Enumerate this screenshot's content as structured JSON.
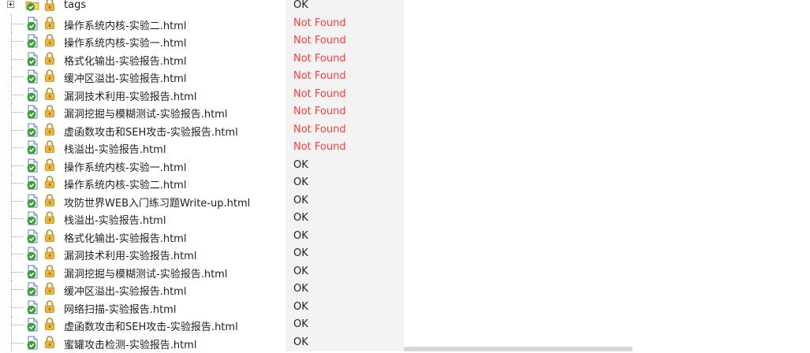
{
  "tree": {
    "root": {
      "name": "tags",
      "status": "OK",
      "status_kind": "ok"
    },
    "items": [
      {
        "name": "操作系统内核-实验二.html",
        "status": "Not Found",
        "status_kind": "nf"
      },
      {
        "name": "操作系统内核-实验一.html",
        "status": "Not Found",
        "status_kind": "nf"
      },
      {
        "name": "格式化输出-实验报告.html",
        "status": "Not Found",
        "status_kind": "nf"
      },
      {
        "name": "缓冲区溢出-实验报告.html",
        "status": "Not Found",
        "status_kind": "nf"
      },
      {
        "name": "漏洞技术利用-实验报告.html",
        "status": "Not Found",
        "status_kind": "nf"
      },
      {
        "name": "漏洞挖掘与模糊测试-实验报告.html",
        "status": "Not Found",
        "status_kind": "nf"
      },
      {
        "name": "虚函数攻击和SEH攻击-实验报告.html",
        "status": "Not Found",
        "status_kind": "nf"
      },
      {
        "name": "栈溢出-实验报告.html",
        "status": "Not Found",
        "status_kind": "nf"
      },
      {
        "name": "操作系统内核-实验一.html",
        "status": "OK",
        "status_kind": "ok"
      },
      {
        "name": "操作系统内核-实验二.html",
        "status": "OK",
        "status_kind": "ok"
      },
      {
        "name": "攻防世界WEB入门练习题Write-up.html",
        "status": "OK",
        "status_kind": "ok"
      },
      {
        "name": "栈溢出-实验报告.html",
        "status": "OK",
        "status_kind": "ok"
      },
      {
        "name": "格式化输出-实验报告.html",
        "status": "OK",
        "status_kind": "ok"
      },
      {
        "name": "漏洞技术利用-实验报告.html",
        "status": "OK",
        "status_kind": "ok"
      },
      {
        "name": "漏洞挖掘与模糊测试-实验报告.html",
        "status": "OK",
        "status_kind": "ok"
      },
      {
        "name": "缓冲区溢出-实验报告.html",
        "status": "OK",
        "status_kind": "ok"
      },
      {
        "name": "网络扫描-实验报告.html",
        "status": "OK",
        "status_kind": "ok"
      },
      {
        "name": "虚函数攻击和SEH攻击-实验报告.html",
        "status": "OK",
        "status_kind": "ok"
      },
      {
        "name": "蜜罐攻击检测-实验报告.html",
        "status": "OK",
        "status_kind": "ok"
      }
    ]
  },
  "colors": {
    "ok": "#222222",
    "not_found": "#ff3b3b",
    "status_column_bg": "#f3f3f3"
  },
  "icons": {
    "root_expander": "plus-box-icon",
    "root_folder": "folder-check-icon",
    "file": "html-file-check-icon",
    "lock": "lock-icon"
  }
}
